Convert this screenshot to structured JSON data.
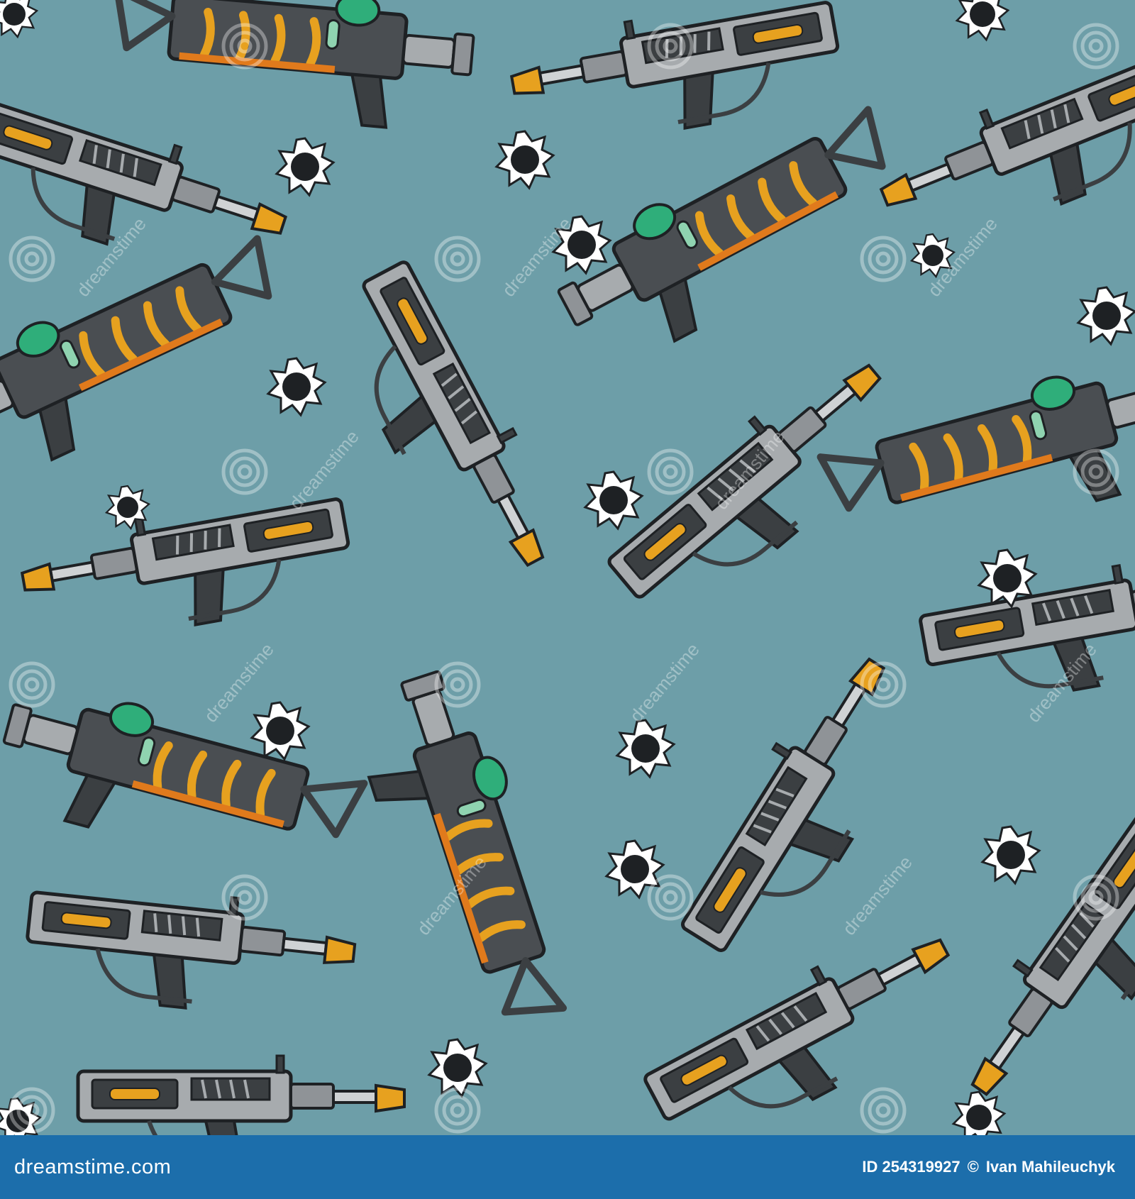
{
  "footer": {
    "brand": "dreamstime.com",
    "image_id": "ID 254319927",
    "author": "Ivan Mahileuchyk"
  },
  "watermark": {
    "text": "dreamstime"
  },
  "colors": {
    "background": "#6d9ea8",
    "footer": "#1c6eab",
    "gun_body": "#a7abae",
    "gun_dark": "#3b3f42",
    "accent_orange": "#e7a11f",
    "canister_green": "#2fae7a"
  },
  "pattern": {
    "icons": [
      "raygun-icon",
      "bullet-hole-icon",
      "spiral-watermark-icon"
    ]
  }
}
